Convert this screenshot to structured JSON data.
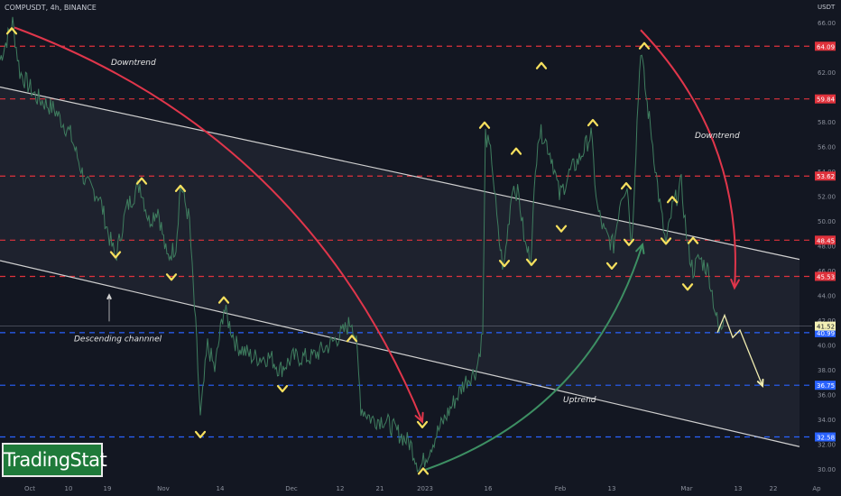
{
  "symbol_label": "COMPUSDT, 4h, BINANCE",
  "logo_text": "TradingStat",
  "chart_data": {
    "type": "candlestick",
    "currency": "USDT",
    "y_range": [
      29.5,
      67
    ],
    "y_ticks": [
      30,
      32,
      34,
      36,
      38,
      40,
      42,
      44,
      46,
      48,
      50,
      52,
      54,
      56,
      58,
      60,
      62,
      64,
      66
    ],
    "x_tick_labels": [
      "Oct",
      "10",
      "19",
      "Nov",
      "14",
      "Dec",
      "12",
      "21",
      "2023",
      "16",
      "Feb",
      "13",
      "Mar",
      "13",
      "22",
      "Ap"
    ],
    "price_levels": [
      {
        "value": 64.09,
        "label": "64.09",
        "color": "#e0323c"
      },
      {
        "value": 59.84,
        "label": "59.84",
        "color": "#e0323c"
      },
      {
        "value": 53.62,
        "label": "53.62",
        "color": "#e0323c"
      },
      {
        "value": 48.45,
        "label": "48.45",
        "color": "#e0323c"
      },
      {
        "value": 45.53,
        "label": "45.53",
        "color": "#e0323c"
      },
      {
        "value": 40.99,
        "label": "40.99",
        "color": "#2962ff"
      },
      {
        "value": 36.75,
        "label": "36.75",
        "color": "#2962ff"
      },
      {
        "value": 32.58,
        "label": "32.58",
        "color": "#2962ff"
      }
    ],
    "current_price": {
      "value": 41.52,
      "label": "41.52"
    },
    "price_path": [
      [
        0,
        63
      ],
      [
        14,
        66
      ],
      [
        22,
        62
      ],
      [
        40,
        60
      ],
      [
        60,
        59
      ],
      [
        78,
        57
      ],
      [
        95,
        53
      ],
      [
        110,
        52
      ],
      [
        120,
        49
      ],
      [
        128,
        47
      ],
      [
        140,
        51
      ],
      [
        155,
        53
      ],
      [
        165,
        50
      ],
      [
        175,
        51
      ],
      [
        185,
        47
      ],
      [
        195,
        48
      ],
      [
        200,
        53
      ],
      [
        210,
        50
      ],
      [
        213,
        46
      ],
      [
        218,
        40
      ],
      [
        222,
        34
      ],
      [
        230,
        40
      ],
      [
        238,
        38
      ],
      [
        248,
        43
      ],
      [
        262,
        40
      ],
      [
        280,
        39
      ],
      [
        300,
        39
      ],
      [
        310,
        38
      ],
      [
        325,
        39
      ],
      [
        345,
        39
      ],
      [
        365,
        40
      ],
      [
        380,
        41
      ],
      [
        390,
        42
      ],
      [
        395,
        40
      ],
      [
        400,
        35
      ],
      [
        412,
        34
      ],
      [
        425,
        34
      ],
      [
        440,
        33
      ],
      [
        455,
        32
      ],
      [
        465,
        30
      ],
      [
        472,
        31
      ],
      [
        485,
        33
      ],
      [
        500,
        35
      ],
      [
        515,
        37
      ],
      [
        528,
        38
      ],
      [
        535,
        41
      ],
      [
        538,
        57
      ],
      [
        545,
        55
      ],
      [
        552,
        49
      ],
      [
        558,
        46
      ],
      [
        568,
        53
      ],
      [
        575,
        52
      ],
      [
        582,
        48
      ],
      [
        588,
        47
      ],
      [
        596,
        57
      ],
      [
        602,
        57
      ],
      [
        612,
        55
      ],
      [
        620,
        52
      ],
      [
        632,
        54
      ],
      [
        642,
        55
      ],
      [
        655,
        57
      ],
      [
        662,
        51
      ],
      [
        670,
        49
      ],
      [
        680,
        48
      ],
      [
        688,
        52
      ],
      [
        695,
        53
      ],
      [
        700,
        48
      ],
      [
        706,
        58
      ],
      [
        710,
        64
      ],
      [
        716,
        60
      ],
      [
        722,
        57
      ],
      [
        730,
        52
      ],
      [
        738,
        48
      ],
      [
        745,
        51
      ],
      [
        755,
        53
      ],
      [
        762,
        48
      ],
      [
        768,
        46
      ],
      [
        775,
        47
      ],
      [
        785,
        46
      ],
      [
        792,
        43
      ],
      [
        797,
        41
      ],
      [
        802,
        42
      ]
    ],
    "trendlines": [
      {
        "from": [
          0,
          60.8
        ],
        "to": [
          886,
          46.9
        ],
        "color": "#cfcfcf"
      },
      {
        "from": [
          0,
          46.8
        ],
        "to": [
          886,
          31.8
        ],
        "color": "#cfcfcf"
      }
    ],
    "projection": [
      [
        795,
        41
      ],
      [
        803,
        42.4
      ],
      [
        812,
        40.6
      ],
      [
        820,
        41.2
      ],
      [
        845,
        36.7
      ]
    ],
    "arrows": [
      {
        "name": "downtrend-arrow-left",
        "from": [
          16,
          65.6
        ],
        "to": [
          468,
          33.8
        ],
        "bend": -0.22,
        "color": "#e0364b"
      },
      {
        "name": "downtrend-arrow-right",
        "from": [
          710,
          65.4
        ],
        "to": [
          814,
          44.6
        ],
        "bend": -0.22,
        "color": "#e0364b"
      },
      {
        "name": "uptrend-arrow",
        "from": [
          470,
          29.9
        ],
        "to": [
          712,
          48.1
        ],
        "bend": 0.25,
        "color": "#3d8f63"
      },
      {
        "name": "channel-pointer",
        "from": [
          121,
          41.9
        ],
        "to": [
          121,
          44
        ],
        "bend": 0,
        "color": "#d0d0d0"
      }
    ],
    "markers_up": [
      [
        13,
        65.4
      ],
      [
        157,
        53.3
      ],
      [
        200,
        52.7
      ],
      [
        248,
        43.7
      ],
      [
        390,
        40.6
      ],
      [
        469,
        29.9
      ],
      [
        537,
        57.8
      ],
      [
        572,
        55.7
      ],
      [
        600,
        62.6
      ],
      [
        657,
        58
      ],
      [
        694,
        52.9
      ],
      [
        714,
        64.2
      ],
      [
        745,
        51.8
      ],
      [
        768,
        48.5
      ]
    ],
    "markers_down": [
      [
        128,
        47.2
      ],
      [
        190,
        45.4
      ],
      [
        222,
        32.7
      ],
      [
        313,
        36.4
      ],
      [
        468,
        33.5
      ],
      [
        559,
        46.5
      ],
      [
        589,
        46.6
      ],
      [
        622,
        49.3
      ],
      [
        678,
        46.3
      ],
      [
        697,
        48.2
      ],
      [
        738,
        48.3
      ],
      [
        762,
        44.6
      ]
    ],
    "annotations": [
      {
        "name": "downtrend-label-left",
        "text": "Downtrend",
        "at": [
          123,
          62.6
        ]
      },
      {
        "name": "downtrend-label-right",
        "text": "Downtrend",
        "at": [
          770,
          56.7
        ]
      },
      {
        "name": "descending-channel-label",
        "text": "Descending channnel",
        "at": [
          82,
          40.3
        ]
      },
      {
        "name": "uptrend-label",
        "text": "Uptrend",
        "at": [
          624,
          35.4
        ]
      }
    ]
  }
}
